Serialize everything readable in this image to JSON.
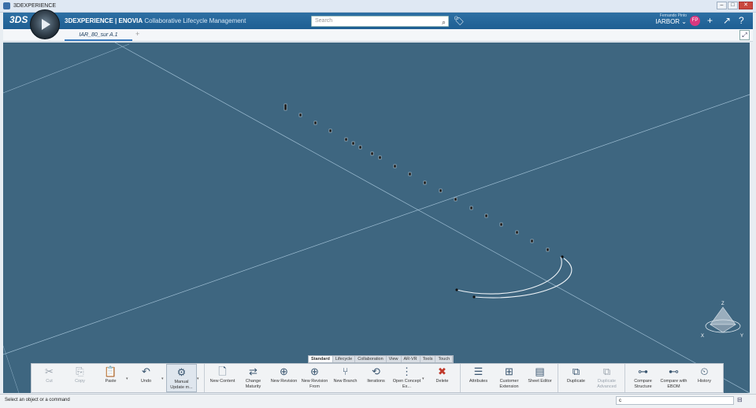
{
  "window": {
    "title": "3DEXPERIENCE",
    "buttons": [
      "–",
      "□",
      "✕"
    ]
  },
  "header": {
    "logo": "3DS",
    "brand_main": "3DEXPERIENCE | ENOVIA",
    "brand_sub": "Collaborative Lifecycle Management",
    "search_placeholder": "Search",
    "user_name": "Fernando Pinto",
    "account": "IARBOR ⌄",
    "avatar_initials": "FP",
    "icons": [
      "search-icon",
      "tag-icon",
      "add-icon",
      "share-icon",
      "help-icon"
    ]
  },
  "tabs": {
    "active": "IAR_80_sur A.1",
    "add": "+"
  },
  "compass": {
    "axes": [
      "Z",
      "X",
      "Y"
    ]
  },
  "toolbar_tabs": [
    "Standard",
    "Lifecycle",
    "Collaboration",
    "View",
    "AR-VR",
    "Tools",
    "Touch"
  ],
  "actions": [
    {
      "label": "Cut",
      "icon": "✂",
      "dim": true
    },
    {
      "label": "Copy",
      "icon": "⎘",
      "dim": true
    },
    {
      "label": "Paste",
      "icon": "📋",
      "dim": false,
      "caret": true
    },
    {
      "label": "Undo",
      "icon": "↶",
      "dim": false,
      "caret": true
    },
    {
      "label": "Manual Update m...",
      "icon": "⚙",
      "dim": false,
      "caret": true,
      "selected": true
    },
    {
      "label": "New Content",
      "icon": "🗋",
      "dim": false
    },
    {
      "label": "Change Maturity",
      "icon": "⇄",
      "dim": false
    },
    {
      "label": "New Revision",
      "icon": "⊕",
      "dim": false
    },
    {
      "label": "New Revision From",
      "icon": "⊕",
      "dim": false
    },
    {
      "label": "New Branch",
      "icon": "⑂",
      "dim": false
    },
    {
      "label": "Iterations",
      "icon": "⟲",
      "dim": false
    },
    {
      "label": "Open Concept Ex...",
      "icon": "⋮",
      "dim": false,
      "caret": true
    },
    {
      "label": "Delete",
      "icon": "✖",
      "dim": false
    },
    {
      "label": "Attributes",
      "icon": "☰",
      "dim": false
    },
    {
      "label": "Customer Extension",
      "icon": "⊞",
      "dim": false
    },
    {
      "label": "Sheet Editor",
      "icon": "▤",
      "dim": false
    },
    {
      "label": "Duplicate",
      "icon": "⧉",
      "dim": false
    },
    {
      "label": "Duplicate Advanced",
      "icon": "⧉",
      "dim": true
    },
    {
      "label": "Compare Structure",
      "icon": "⊶",
      "dim": false
    },
    {
      "label": "Compare with EBOM",
      "icon": "⊷",
      "dim": false
    },
    {
      "label": "History",
      "icon": "⏲",
      "dim": false
    }
  ],
  "status": {
    "message": "Select an object or a command",
    "command_value": "c"
  }
}
